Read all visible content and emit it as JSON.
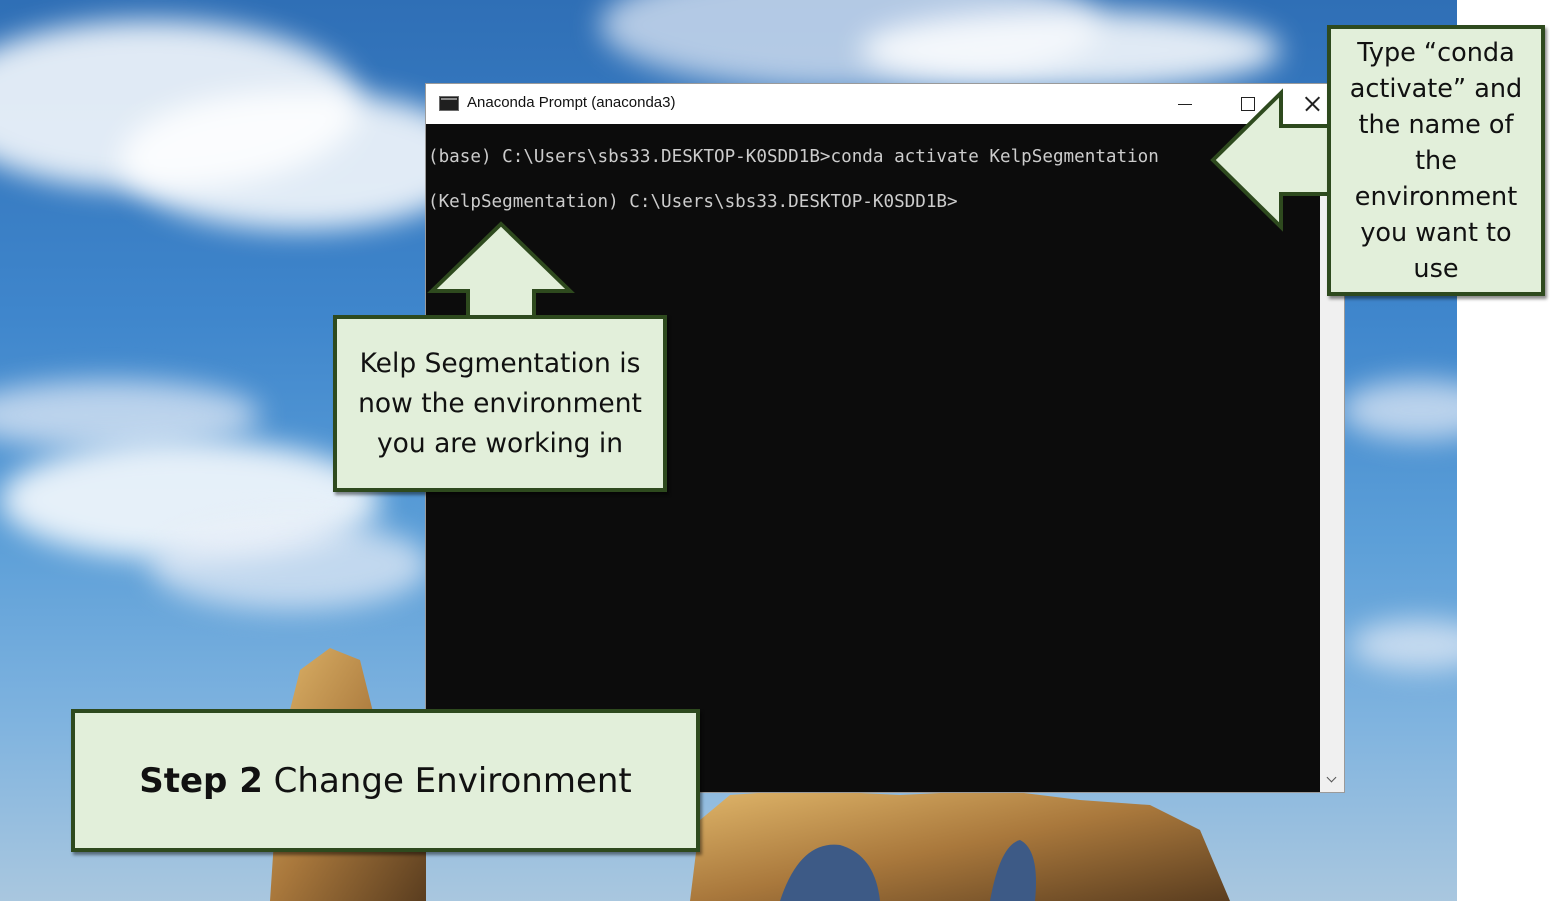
{
  "window": {
    "title": "Anaconda Prompt (anaconda3)",
    "icon": "console-icon",
    "controls": [
      "minimize-icon",
      "maximize-icon",
      "close-icon"
    ]
  },
  "console": {
    "lines": [
      "(base) C:\\Users\\sbs33.DESKTOP-K0SDD1B>conda activate KelpSegmentation",
      "(KelpSegmentation) C:\\Users\\sbs33.DESKTOP-K0SDD1B>"
    ]
  },
  "callouts": {
    "command_hint": "Type “conda activate” and the name of the environment you want to use",
    "environment_note": "Kelp Segmentation is now the environment you are working in",
    "step_number": "Step 2",
    "step_title": " Change Environment"
  },
  "colors": {
    "callout_fill": "#e2efda",
    "callout_border": "#2e4a1e",
    "console_bg": "#0c0c0c",
    "console_text": "#cccccc"
  }
}
